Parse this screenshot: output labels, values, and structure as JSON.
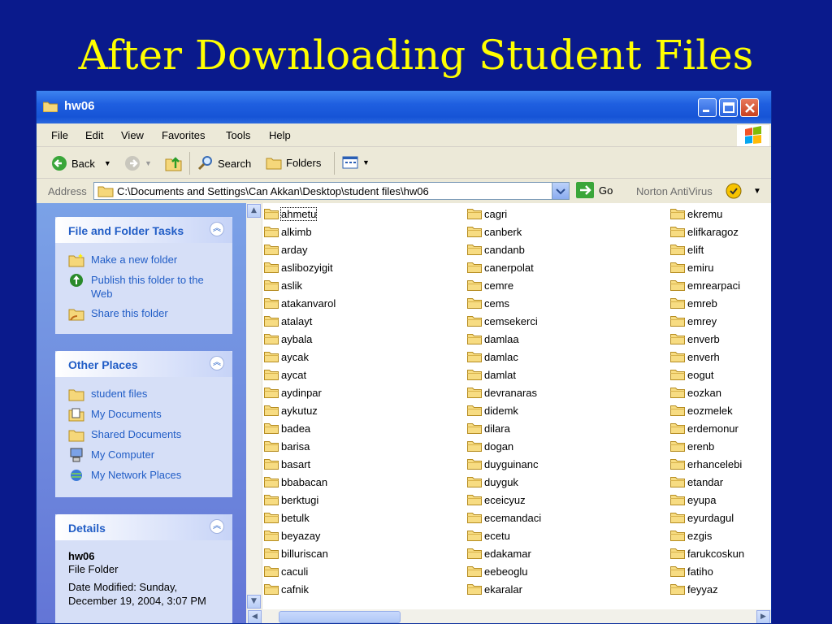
{
  "slide": {
    "title": "After Downloading Student Files"
  },
  "window": {
    "title": "hw06"
  },
  "menu": [
    "File",
    "Edit",
    "View",
    "Favorites",
    "Tools",
    "Help"
  ],
  "toolbar": {
    "back": "Back",
    "search": "Search",
    "folders": "Folders"
  },
  "address": {
    "label": "Address",
    "value": "C:\\Documents and Settings\\Can Akkan\\Desktop\\student files\\hw06",
    "go": "Go",
    "norton": "Norton AntiVirus"
  },
  "tasks": {
    "file_folder": {
      "title": "File and Folder Tasks",
      "items": [
        "Make a new folder",
        "Publish this folder to the Web",
        "Share this folder"
      ]
    },
    "other_places": {
      "title": "Other Places",
      "items": [
        "student files",
        "My Documents",
        "Shared Documents",
        "My Computer",
        "My Network Places"
      ]
    },
    "details": {
      "title": "Details",
      "name": "hw06",
      "type": "File Folder",
      "modified_line1": "Date Modified: Sunday,",
      "modified_line2": "December 19, 2004, 3:07 PM"
    }
  },
  "files": {
    "col1": [
      "ahmetu",
      "alkimb",
      "arday",
      "aslibozyigit",
      "aslik",
      "atakanvarol",
      "atalayt",
      "aybala",
      "aycak",
      "aycat",
      "aydinpar",
      "aykutuz",
      "badea",
      "barisa",
      "basart",
      "bbabacan",
      "berktugi",
      "betulk",
      "beyazay",
      "billuriscan",
      "caculi",
      "cafnik"
    ],
    "col2": [
      "cagri",
      "canberk",
      "candanb",
      "canerpolat",
      "cemre",
      "cems",
      "cemsekerci",
      "damlaa",
      "damlac",
      "damlat",
      "devranaras",
      "didemk",
      "dilara",
      "dogan",
      "duyguinanc",
      "duyguk",
      "eceicyuz",
      "ecemandaci",
      "ecetu",
      "edakamar",
      "eebeoglu",
      "ekaralar"
    ],
    "col3": [
      "ekremu",
      "elifkaragoz",
      "elift",
      "emiru",
      "emrearpaci",
      "emreb",
      "emrey",
      "enverb",
      "enverh",
      "eogut",
      "eozkan",
      "eozmelek",
      "erdemonur",
      "erenb",
      "erhancelebi",
      "etandar",
      "eyupa",
      "eyurdagul",
      "ezgis",
      "farukcoskun",
      "fatiho",
      "feyyaz"
    ]
  },
  "icons": {
    "folder": "folder-icon",
    "back": "back-arrow-icon",
    "forward": "forward-arrow-icon",
    "up": "up-folder-icon",
    "search": "magnifier-icon",
    "views": "views-icon"
  },
  "colors": {
    "slide_bg": "#0a1a8c",
    "title": "#ffff00",
    "link": "#215dc6"
  }
}
